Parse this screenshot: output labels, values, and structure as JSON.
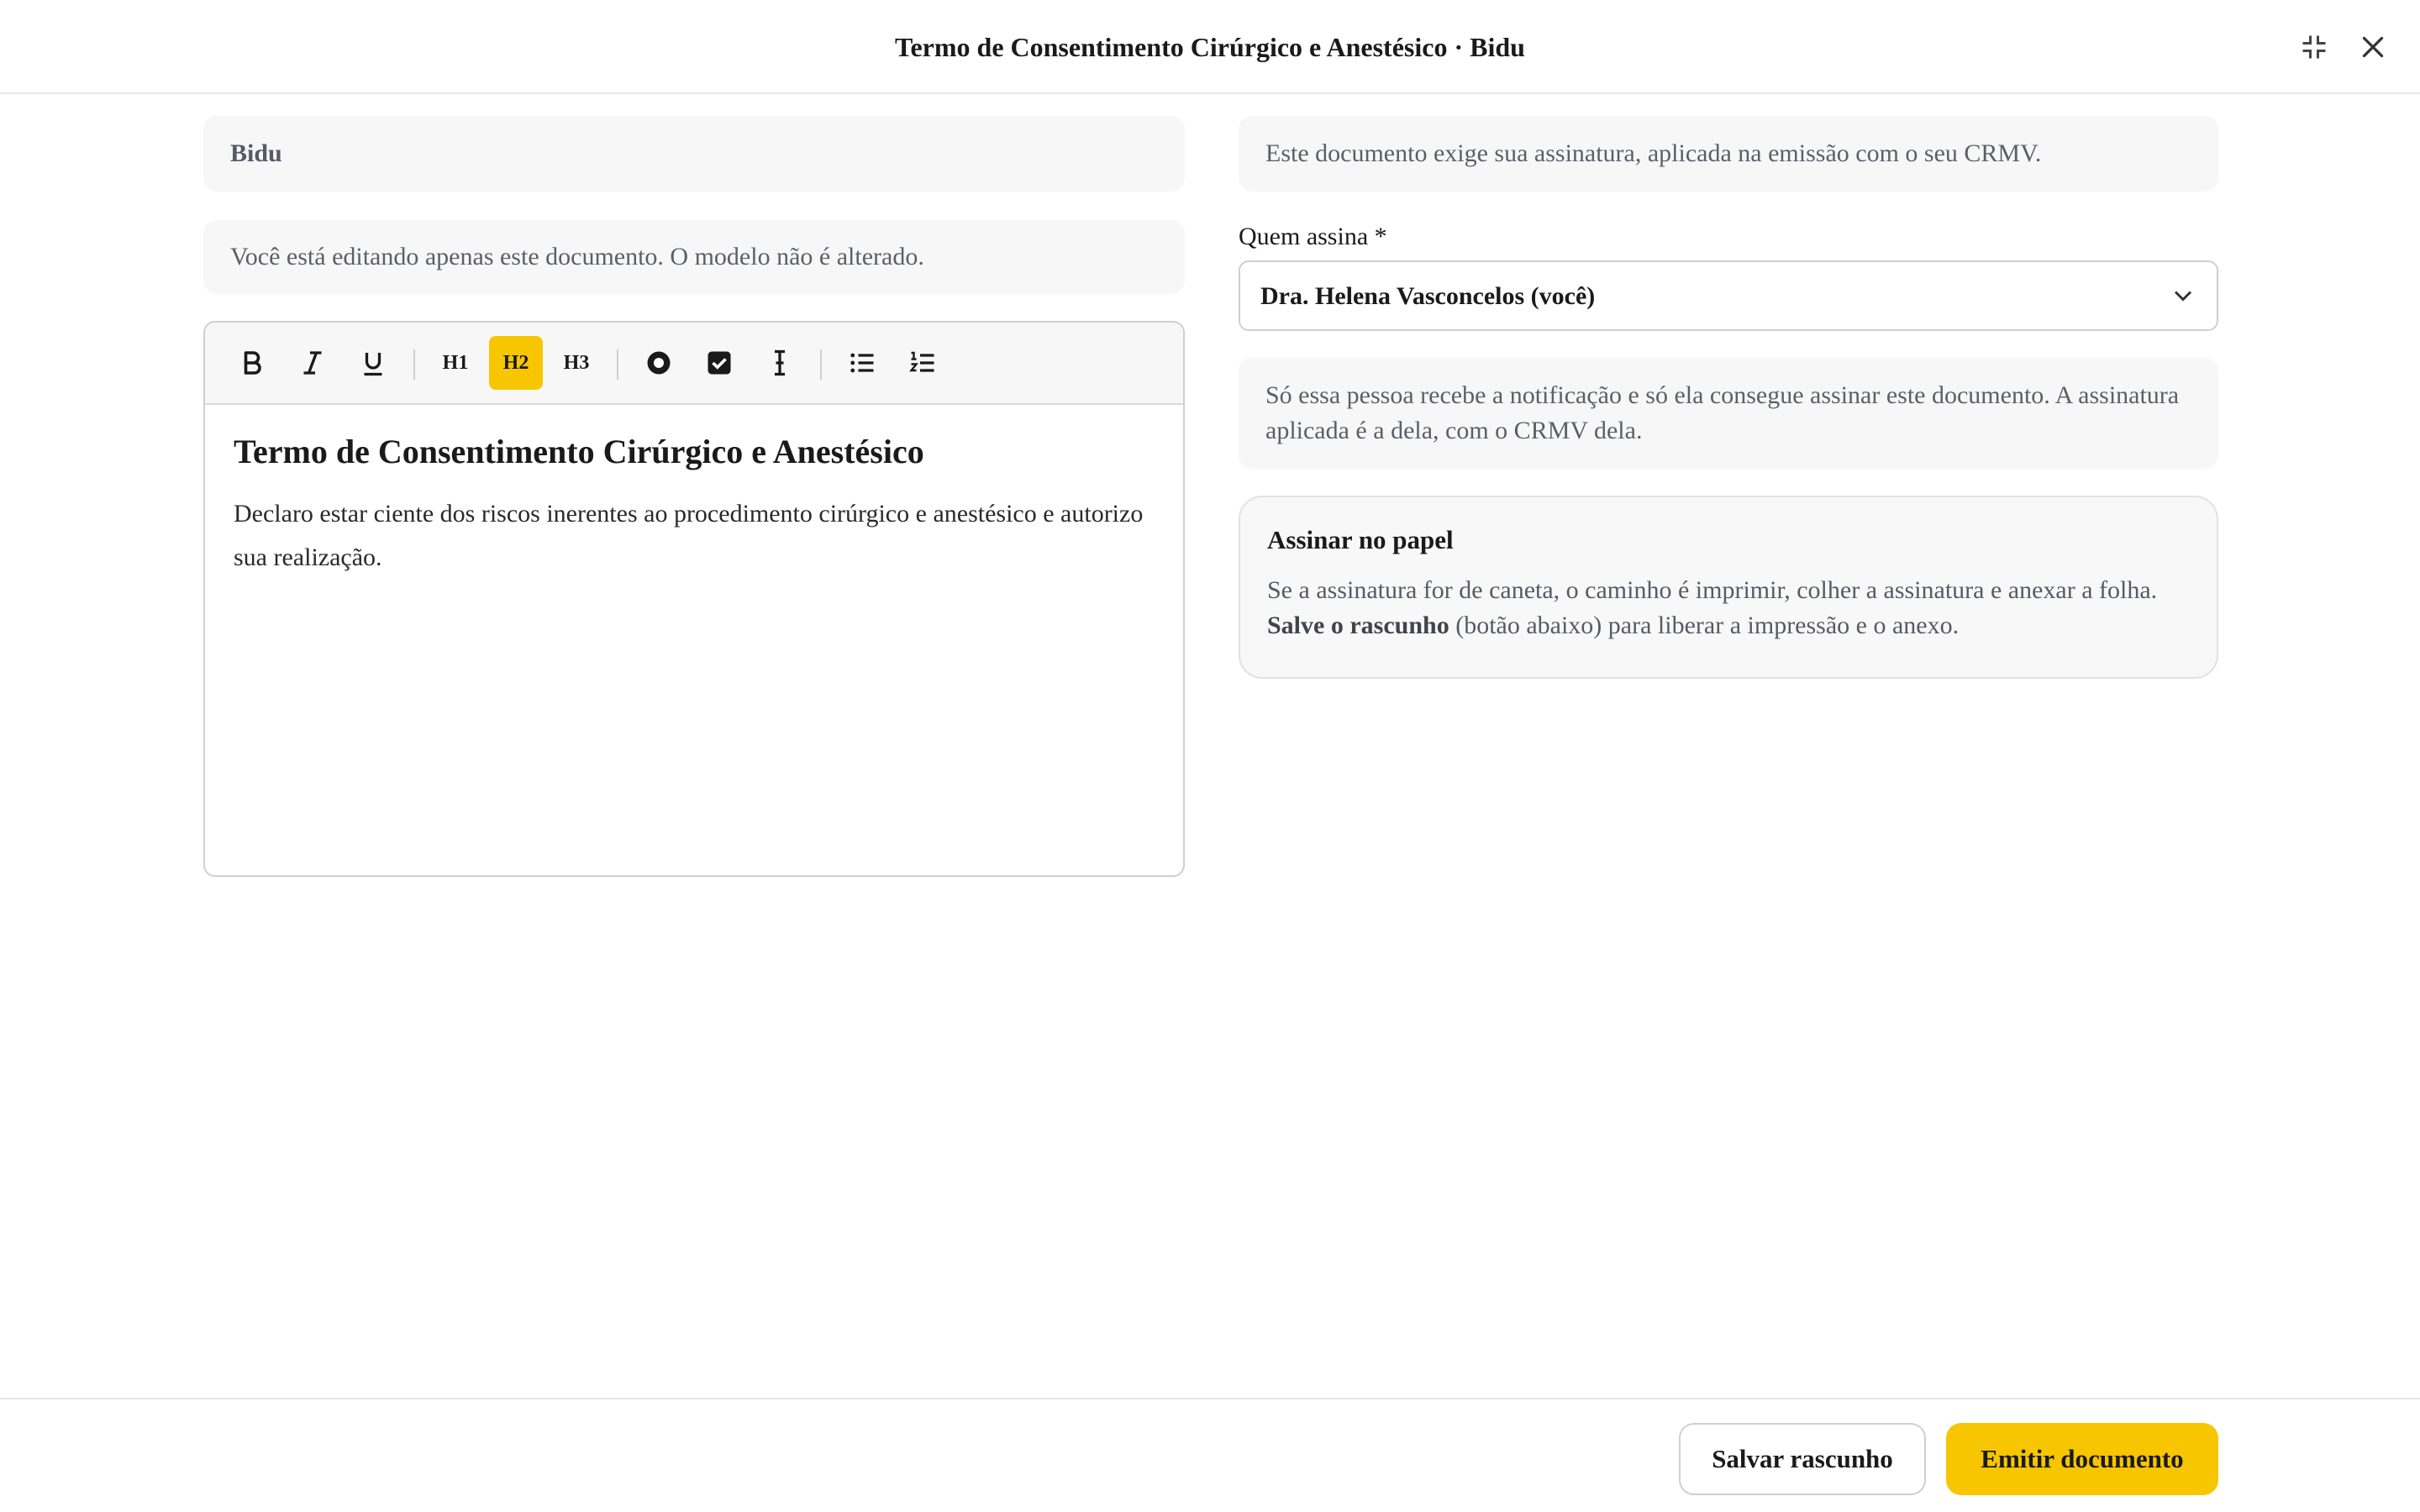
{
  "header": {
    "title": "Termo de Consentimento Cirúrgico e Anestésico · Bidu",
    "icons": {
      "minimize": "collapse-icon",
      "close": "close-icon"
    }
  },
  "left": {
    "patient_name": "Bidu",
    "notice": "Você está editando apenas este documento. O modelo não é alterado.",
    "toolbar": {
      "h1": "H1",
      "h2": "H2",
      "h3": "H3",
      "active": "H2",
      "icons": [
        "bold-icon",
        "italic-icon",
        "underline-icon",
        "radio-icon",
        "checkbox-icon",
        "text-field-icon",
        "bullet-list-icon",
        "numbered-list-icon"
      ]
    },
    "editor": {
      "heading": "Termo de Consentimento Cirúrgico e Anestésico",
      "body": "Declaro estar ciente dos riscos inerentes ao procedimento cirúrgico e anestésico e autorizo sua realização."
    }
  },
  "right": {
    "info": "Este documento exige sua assinatura, aplicada na emissão com o seu CRMV.",
    "signer_label": "Quem assina *",
    "signer_value": "Dra. Helena Vasconcelos (você)",
    "help": "Só essa pessoa recebe a notificação e só ela consegue assinar este documento. A assinatura aplicada é a dela, com o CRMV dela.",
    "paper": {
      "title": "Assinar no papel",
      "text_1": "Se a assinatura for de caneta, o caminho é imprimir, colher a assinatura e anexar a folha.",
      "text_bold": "Salve o rascunho",
      "text_2": " (botão abaixo) para liberar a impressão e o anexo."
    }
  },
  "footer": {
    "save_draft": "Salvar rascunho",
    "emit": "Emitir documento"
  },
  "colors": {
    "accent": "#f7c600",
    "muted_bg": "#f7f7f8"
  }
}
